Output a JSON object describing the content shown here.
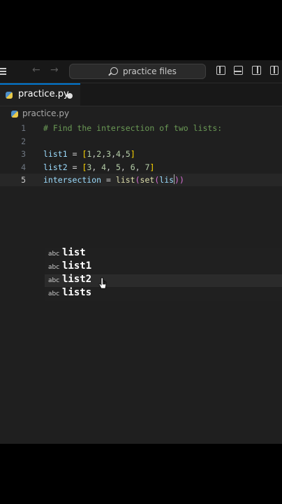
{
  "titlebar": {
    "search_text": "practice files",
    "icons": [
      "menu-icon",
      "back-arrow-icon",
      "forward-arrow-icon",
      "search-icon",
      "toggle-sidebar-icon",
      "toggle-panel-icon",
      "toggle-secondary-sidebar-icon",
      "customize-layout-icon"
    ]
  },
  "tab": {
    "label": "practice.py",
    "modified": true
  },
  "breadcrumb": {
    "file": "practice.py"
  },
  "code_lines": [
    {
      "number": "1",
      "text": "# Find the intersection of two lists:"
    },
    {
      "number": "2",
      "text": ""
    },
    {
      "number": "3",
      "text": "list1 = [1,2,3,4,5]"
    },
    {
      "number": "4",
      "text": "list2 = [3, 4, 5, 6, 7]"
    },
    {
      "number": "5",
      "text": "intersection = list(set(lis))"
    }
  ],
  "current_line": 5,
  "suggestions": {
    "kind_label": "abc",
    "items": [
      "list",
      "list1",
      "list2",
      "lists"
    ],
    "selected_index": 2
  },
  "colors": {
    "comment": "#6a9955",
    "number": "#b5cea8",
    "bracket": "#ffd700",
    "function": "#dcdcaa",
    "variable": "#9cdcfe",
    "accent": "#0078d4"
  }
}
